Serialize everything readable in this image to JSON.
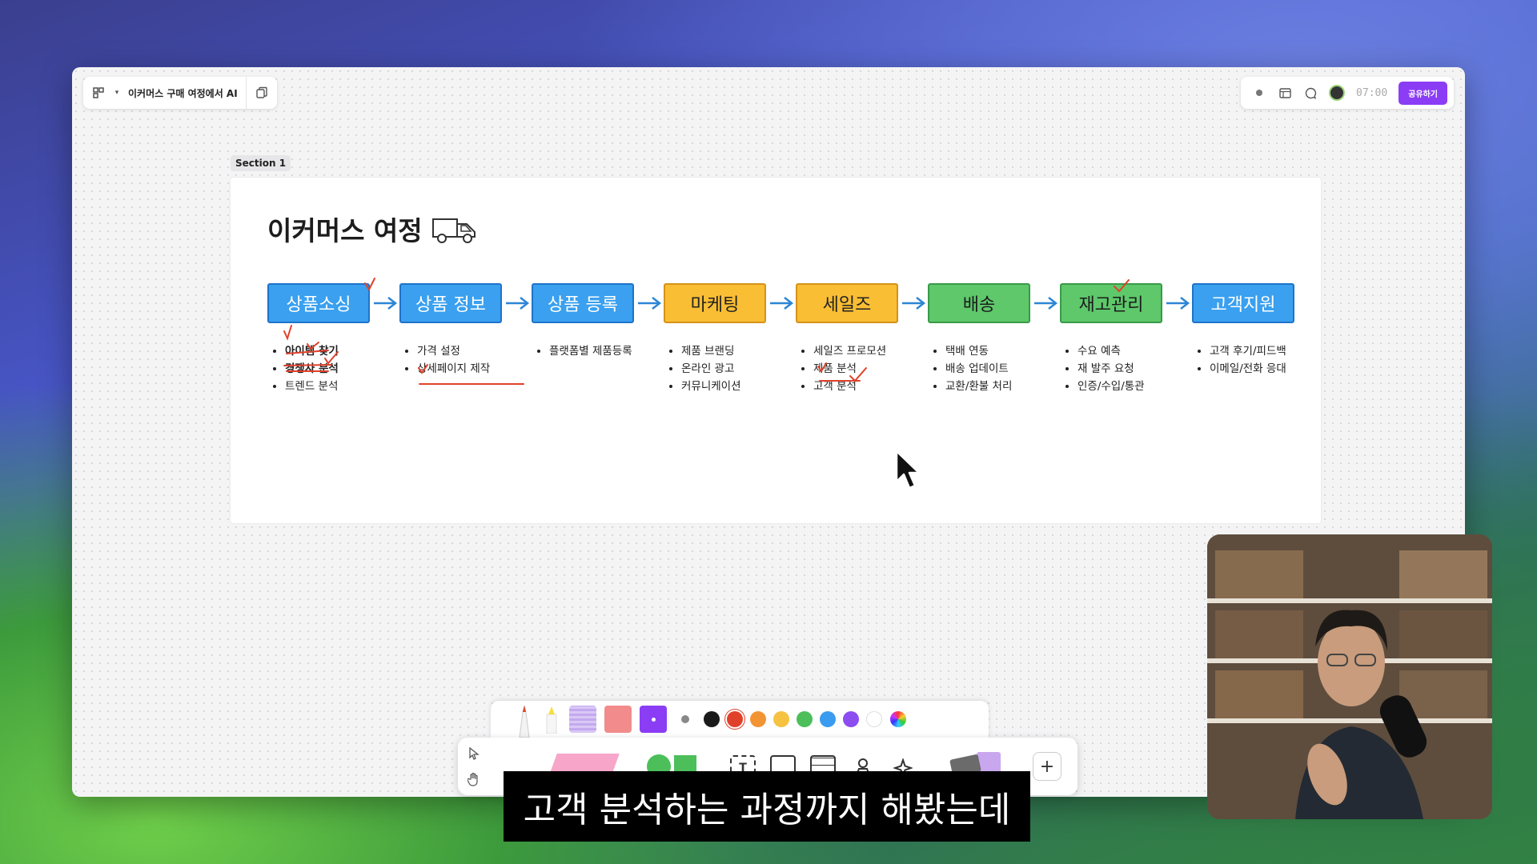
{
  "app": {
    "doc_title": "이커머스 구매 여정에서 AI",
    "timer": "07:00",
    "share_label": "공유하기"
  },
  "section": {
    "tag": "Section 1",
    "title": "이커머스 여정"
  },
  "steps": [
    {
      "label": "상품소싱",
      "color": "blue",
      "bullets": [
        "아이템 찾기",
        "경쟁사 분석",
        "트렌드 분석"
      ],
      "bold": [
        0,
        1
      ]
    },
    {
      "label": "상품 정보",
      "color": "blue",
      "bullets": [
        "가격 설정",
        "상세페이지 제작"
      ],
      "bold": []
    },
    {
      "label": "상품 등록",
      "color": "blue",
      "bullets": [
        "플랫폼별 제품등록"
      ],
      "bold": []
    },
    {
      "label": "마케팅",
      "color": "yellow",
      "bullets": [
        "제품 브랜딩",
        "온라인 광고",
        "커뮤니케이션"
      ],
      "bold": []
    },
    {
      "label": "세일즈",
      "color": "yellow",
      "bullets": [
        "세일즈 프로모션",
        "제품 분석",
        "고객 분석"
      ],
      "bold": []
    },
    {
      "label": "배송",
      "color": "green",
      "bullets": [
        "택배 연동",
        "배송 업데이트",
        "교환/환불 처리"
      ],
      "bold": []
    },
    {
      "label": "재고관리",
      "color": "green",
      "bullets": [
        "수요 예측",
        "재 발주 요청",
        "인증/수입/통관"
      ],
      "bold": []
    },
    {
      "label": "고객지원",
      "color": "blue",
      "bullets": [
        "고객 후기/피드백",
        "이메일/전화 응대"
      ],
      "bold": []
    }
  ],
  "palette_colors": [
    "#1a1a1a",
    "#e0412b",
    "#f29434",
    "#f5c242",
    "#4cbf5a",
    "#3a9cf0",
    "#8b4cf0",
    "#ffffff"
  ],
  "subtitle": "고객 분석하는 과정까지 해봤는데"
}
